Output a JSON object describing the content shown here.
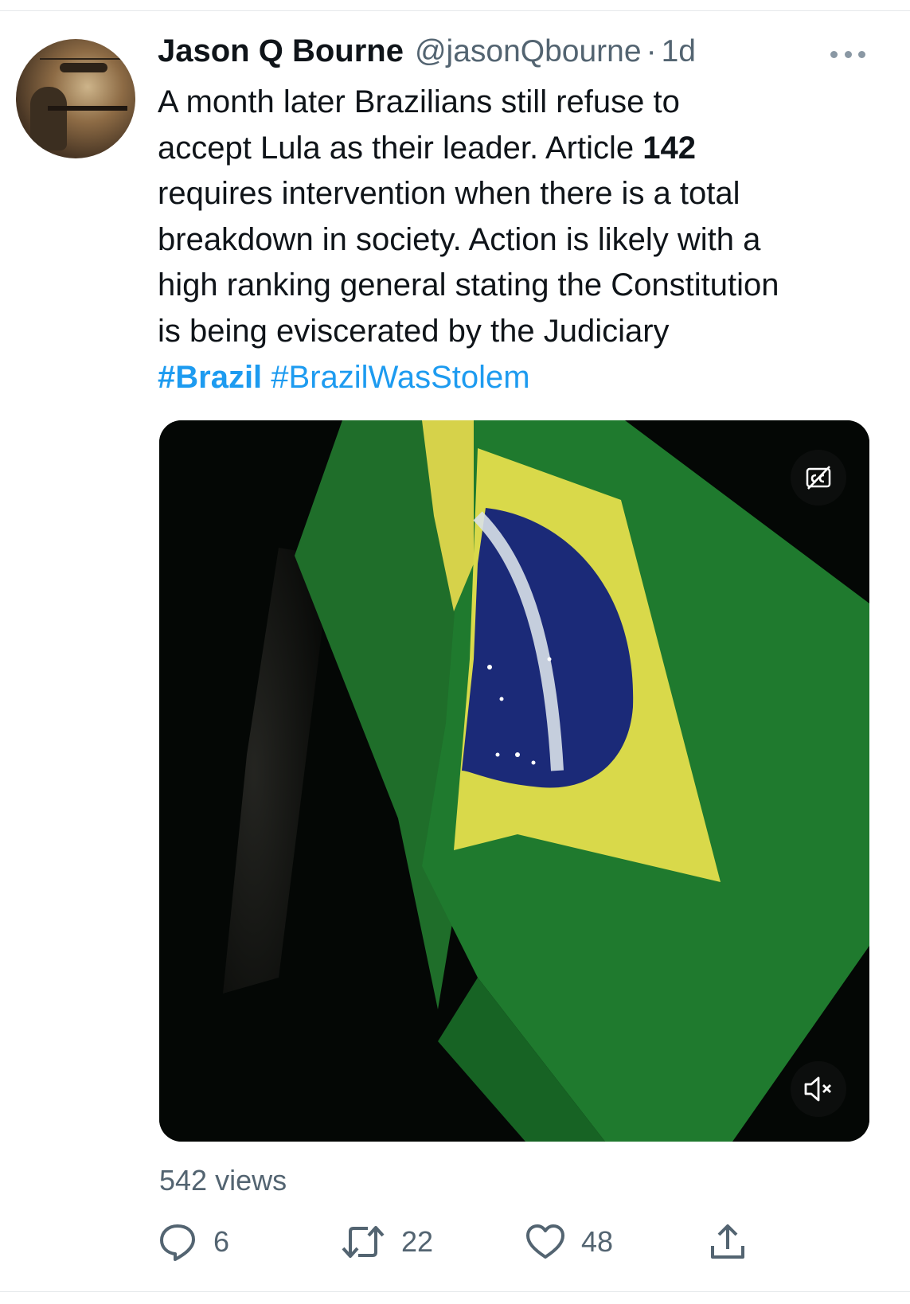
{
  "tweet": {
    "author_name": "Jason Q Bourne",
    "author_handle": "@jasonQbourne",
    "separator": "·",
    "timestamp": "1d",
    "text_lines": [
      "A month later Brazilians still refuse to",
      "accept Lula as their leader. Article ",
      "requires intervention when there is a total",
      "breakdown in society. Action is likely with a",
      "high ranking general stating the Constitution",
      "is being eviscerated by the Judiciary"
    ],
    "bold_number": "142",
    "hashtags": [
      "#Brazil",
      "#BrazilWasStolem"
    ],
    "views": "542 views",
    "stats": {
      "replies": "6",
      "retweets": "22",
      "likes": "48"
    }
  },
  "media": {
    "type": "video",
    "subject": "Brazilian flag",
    "controls": {
      "captions_icon": "captions-off-icon",
      "mute_icon": "muted-speaker-icon"
    }
  },
  "icons": {
    "more": "more-options-icon",
    "reply": "reply-icon",
    "retweet": "retweet-icon",
    "like": "heart-icon",
    "share": "share-icon"
  },
  "colors": {
    "link": "#1d9bf0",
    "secondary_text": "#536471",
    "flag_green": "#1f7a2e",
    "flag_yellow": "#d9d94a",
    "flag_blue": "#1b2a78"
  }
}
